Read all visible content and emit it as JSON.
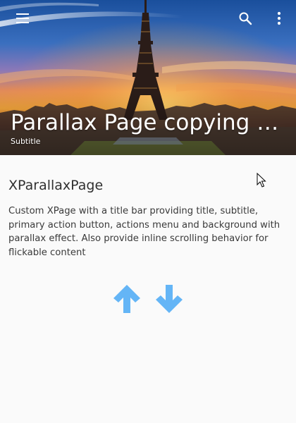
{
  "app_bar": {
    "title": "Parallax Page copying Go…",
    "subtitle": "Subtitle",
    "menu_icon": "menu-icon",
    "search_icon": "search-icon",
    "more_icon": "more-vert-icon"
  },
  "content": {
    "heading": "XParallaxPage",
    "description": "Custom XPage with a title bar providing title, subtitle, primary action button, actions menu and background with parallax effect. Also provide inline scrolling behavior for flickable content"
  },
  "controls": {
    "up_icon": "arrow-up-icon",
    "down_icon": "arrow-down-icon"
  },
  "colors": {
    "accent": "#64b5f6",
    "background": "#fafafa",
    "text": "#303030"
  }
}
